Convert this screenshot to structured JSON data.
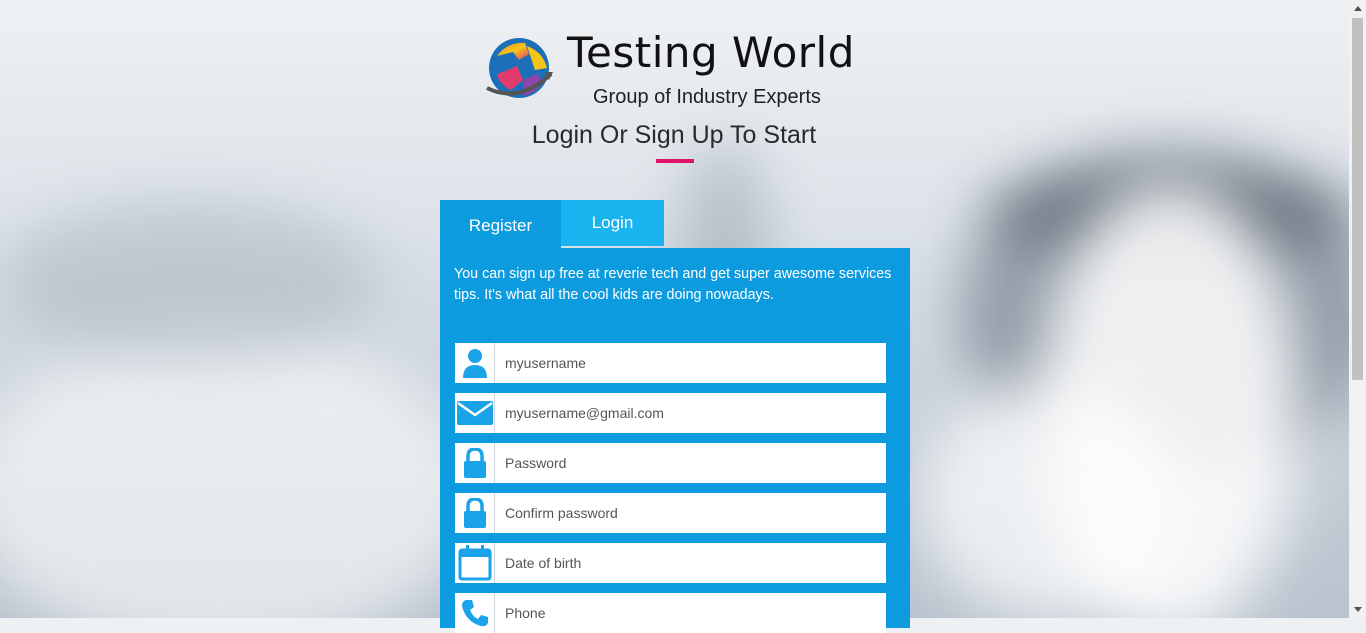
{
  "logo": {
    "title": "Testing World",
    "subtitle": "Group of Industry Experts",
    "icon": "globe-puzzle-logo"
  },
  "headline": "Login Or Sign Up To Start",
  "colors": {
    "accent_blue": "#0d9be0",
    "tab_login_blue": "#19b4ef",
    "underline_pink": "#e0136b",
    "icon_blue": "#1aa3e8"
  },
  "tabs": {
    "register": "Register",
    "login": "Login"
  },
  "intro": "You can sign up free at reverie tech and get super awesome services tips. It's what all the cool kids are doing nowadays.",
  "fields": [
    {
      "icon": "user-icon",
      "placeholder": "myusername"
    },
    {
      "icon": "envelope-icon",
      "placeholder": "myusername@gmail.com"
    },
    {
      "icon": "lock-icon",
      "placeholder": "Password"
    },
    {
      "icon": "lock-icon",
      "placeholder": "Confirm password"
    },
    {
      "icon": "calendar-icon",
      "placeholder": "Date of birth"
    },
    {
      "icon": "phone-icon",
      "placeholder": "Phone"
    }
  ]
}
